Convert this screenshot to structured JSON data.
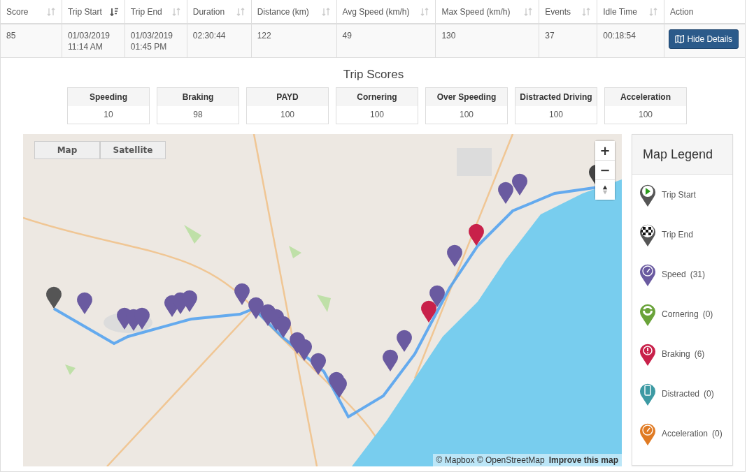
{
  "table": {
    "columns": [
      {
        "label": "Score",
        "sorted": false
      },
      {
        "label": "Trip Start",
        "sorted": true
      },
      {
        "label": "Trip End",
        "sorted": false
      },
      {
        "label": "Duration",
        "sorted": false
      },
      {
        "label": "Distance (km)",
        "sorted": false
      },
      {
        "label": "Avg Speed (km/h)",
        "sorted": false
      },
      {
        "label": "Max Speed (km/h)",
        "sorted": false
      },
      {
        "label": "Events",
        "sorted": false
      },
      {
        "label": "Idle Time",
        "sorted": false
      },
      {
        "label": "Action"
      }
    ],
    "rows": [
      {
        "cells": [
          [
            "85"
          ],
          [
            "01/03/2019",
            "11:14 AM"
          ],
          [
            "01/03/2019",
            "01:45 PM"
          ],
          [
            "02:30:44"
          ],
          [
            "122"
          ],
          [
            "49"
          ],
          [
            "130"
          ],
          [
            "37"
          ],
          [
            "00:18:54"
          ]
        ],
        "action": "Hide Details"
      }
    ]
  },
  "trip_scores": {
    "title": "Trip Scores",
    "items": [
      {
        "label": "Speeding",
        "value": "10"
      },
      {
        "label": "Braking",
        "value": "98"
      },
      {
        "label": "PAYD",
        "value": "100"
      },
      {
        "label": "Cornering",
        "value": "100"
      },
      {
        "label": "Over Speeding",
        "value": "100"
      },
      {
        "label": "Distracted Driving",
        "value": "100"
      },
      {
        "label": "Acceleration",
        "value": "100"
      }
    ]
  },
  "map": {
    "kind": "picture",
    "view_tabs": [
      "Map",
      "Satellite"
    ],
    "zoom_in": "+",
    "zoom_out": "−",
    "attribution": "© Mapbox © OpenStreetMap",
    "improve_link": "Improve this map"
  },
  "legend": {
    "title": "Map Legend",
    "items": [
      {
        "kind": "start",
        "label": "Trip Start",
        "color": "#555555"
      },
      {
        "kind": "end",
        "label": "Trip End",
        "color": "#555555"
      },
      {
        "kind": "speed",
        "label": "Speed",
        "count": "(31)",
        "color": "#6a5aa0"
      },
      {
        "kind": "cornering",
        "label": "Cornering",
        "count": "(0)",
        "color": "#6aa33a"
      },
      {
        "kind": "braking",
        "label": "Braking",
        "count": "(6)",
        "color": "#c8214a"
      },
      {
        "kind": "distracted",
        "label": "Distracted",
        "count": "(0)",
        "color": "#3d9aa3"
      },
      {
        "kind": "acceleration",
        "label": "Acceleration",
        "count": "(0)",
        "color": "#e07b24"
      }
    ]
  }
}
